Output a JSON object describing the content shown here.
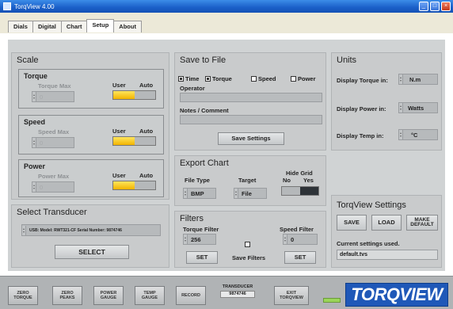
{
  "window": {
    "title": "TorqView 4.00"
  },
  "tabs": [
    "Dials",
    "Digital",
    "Chart",
    "Setup",
    "About"
  ],
  "active_tab": "Setup",
  "scale": {
    "title": "Scale",
    "torque": {
      "title": "Torque",
      "max_label": "Torque Max",
      "max_value": "0",
      "user_label": "User",
      "auto_label": "Auto",
      "mode": "User"
    },
    "speed": {
      "title": "Speed",
      "max_label": "Speed Max",
      "max_value": "0",
      "user_label": "User",
      "auto_label": "Auto",
      "mode": "User"
    },
    "power": {
      "title": "Power",
      "max_label": "Power Max",
      "max_value": "0",
      "user_label": "User",
      "auto_label": "Auto",
      "mode": "User"
    }
  },
  "save_to_file": {
    "title": "Save to File",
    "checkboxes": [
      {
        "label": "Time",
        "checked": true
      },
      {
        "label": "Torque",
        "checked": true
      },
      {
        "label": "Speed",
        "checked": false
      },
      {
        "label": "Power",
        "checked": false
      }
    ],
    "operator_label": "Operator",
    "operator_value": "",
    "notes_label": "Notes / Comment",
    "notes_value": "",
    "save_settings_label": "Save Settings"
  },
  "units": {
    "title": "Units",
    "torque_label": "Display Torque in:",
    "torque_value": "N.m",
    "power_label": "Display Power in:",
    "power_value": "Watts",
    "temp_label": "Display Temp in:",
    "temp_value": "°C"
  },
  "export_chart": {
    "title": "Export Chart",
    "file_type_label": "File Type",
    "file_type_value": "BMP",
    "target_label": "Target",
    "target_value": "File",
    "hide_grid_label": "Hide Grid",
    "no_label": "No",
    "yes_label": "Yes",
    "hide_grid_value": "Yes"
  },
  "select_transducer": {
    "title": "Select Transducer",
    "selected": "USB: Model: RWT321-CF Serial Number: 9874746",
    "select_label": "SELECT"
  },
  "filters": {
    "title": "Filters",
    "torque_filter_label": "Torque Filter",
    "torque_filter_value": "256",
    "speed_filter_label": "Speed Filter",
    "speed_filter_value": "0",
    "set_label": "SET",
    "save_filters_label": "Save Filters"
  },
  "torqview_settings": {
    "title": "TorqView Settings",
    "save_label": "SAVE",
    "load_label": "LOAD",
    "make_default_line1": "MAKE",
    "make_default_line2": "DEFAULT",
    "current_label": "Current settings used.",
    "current_value": "default.tvs"
  },
  "bottom_bar": {
    "buttons": [
      {
        "line1": "ZERO",
        "line2": "TORQUE"
      },
      {
        "line1": "ZERO",
        "line2": "PEAKS"
      },
      {
        "line1": "POWER",
        "line2": "GAUGE"
      },
      {
        "line1": "TEMP",
        "line2": "GAUGE"
      },
      {
        "line1": "RECORD",
        "line2": ""
      },
      {
        "line1": "EXIT",
        "line2": "TORQVIEW"
      }
    ],
    "transducer_label": "TRANSDUCER",
    "transducer_value": "9874746",
    "logo_text": "TORQVIEW"
  },
  "colors": {
    "title_bar": "#1a5fc8",
    "panel": "#d0d3d4",
    "toggle_on": "#f2b400",
    "logo": "#1f58b8",
    "led": "#9bd55a"
  }
}
